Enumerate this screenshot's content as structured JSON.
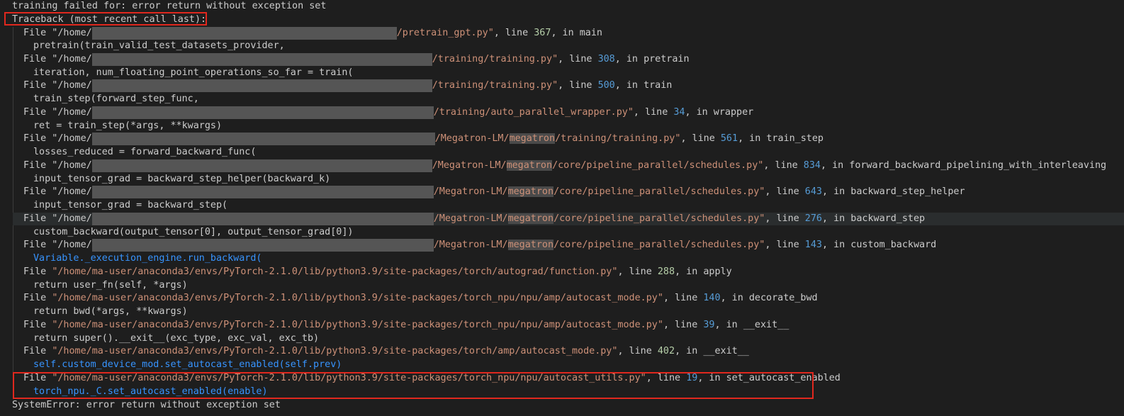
{
  "terminal": {
    "header": "training failed for: error return without exception set",
    "traceback_header": "Traceback (most recent call last):",
    "frames": [
      {
        "prefix": "File \"/home/",
        "path_suffix": "/pretrain_gpt.py",
        "line_label": ", line ",
        "line_no": "367",
        "in_label": ", in ",
        "func": "main",
        "code": "pretrain(train_valid_test_datasets_provider,"
      },
      {
        "prefix": "File \"/home/",
        "path_suffix": "/training/training.py",
        "line_label": ", line ",
        "line_no": "308",
        "in_label": ", in ",
        "func": "pretrain",
        "code": "iteration, num_floating_point_operations_so_far = train("
      },
      {
        "prefix": "File \"/home/",
        "path_suffix": "/training/training.py",
        "line_label": ", line ",
        "line_no": "500",
        "in_label": ", in ",
        "func": "train",
        "code": "train_step(forward_step_func,"
      },
      {
        "prefix": "File \"/home/",
        "path_suffix": "/training/auto_parallel_wrapper.py",
        "line_label": ", line ",
        "line_no": "34",
        "in_label": ", in ",
        "func": "wrapper",
        "code": "ret = train_step(*args, **kwargs)"
      },
      {
        "prefix": "File \"/home/",
        "path_a": "/Megatron-LM/",
        "path_hl": "megatron",
        "path_b": "/training/training.py",
        "line_label": ", line ",
        "line_no": "561",
        "in_label": ", in ",
        "func": "train_step",
        "code": "losses_reduced = forward_backward_func("
      },
      {
        "prefix": "File \"/home/",
        "path_a": "/Megatron-LM/",
        "path_hl": "megatron",
        "path_b": "/core/pipeline_parallel/schedules.py",
        "line_label": ", line ",
        "line_no": "834",
        "in_label": ", in ",
        "func": "forward_backward_pipelining_with_interleaving",
        "code": "input_tensor_grad = backward_step_helper(backward_k)"
      },
      {
        "prefix": "File \"/home/",
        "path_a": "/Megatron-LM/",
        "path_hl": "megatron",
        "path_b": "/core/pipeline_parallel/schedules.py",
        "line_label": ", line ",
        "line_no": "643",
        "in_label": ", in ",
        "func": "backward_step_helper",
        "code": "input_tensor_grad = backward_step("
      },
      {
        "prefix": "File \"/home/",
        "path_a": "/Megatron-LM/",
        "path_hl": "megatron",
        "path_b": "/core/pipeline_parallel/schedules.py",
        "line_label": ", line ",
        "line_no": "276",
        "in_label": ", in ",
        "func": "backward_step",
        "code": "custom_backward(output_tensor[0], output_tensor_grad[0])"
      },
      {
        "prefix": "File \"/home/",
        "path_a": "/Megatron-LM/",
        "path_hl": "megatron",
        "path_b": "/core/pipeline_parallel/schedules.py",
        "line_label": ", line ",
        "line_no": "143",
        "in_label": ", in ",
        "func": "custom_backward",
        "code": "Variable._execution_engine.run_backward("
      },
      {
        "prefix": "File ",
        "path": "\"/home/ma-user/anaconda3/envs/PyTorch-2.1.0/lib/python3.9/site-packages/torch/autograd/function.py\"",
        "line_label": ", line ",
        "line_no": "288",
        "in_label": ", in ",
        "func": "apply",
        "code": "return user_fn(self, *args)"
      },
      {
        "prefix": "File ",
        "path": "\"/home/ma-user/anaconda3/envs/PyTorch-2.1.0/lib/python3.9/site-packages/torch_npu/npu/amp/autocast_mode.py\"",
        "line_label": ", line ",
        "line_no": "140",
        "in_label": ", in ",
        "func": "decorate_bwd",
        "code": "return bwd(*args, **kwargs)"
      },
      {
        "prefix": "File ",
        "path": "\"/home/ma-user/anaconda3/envs/PyTorch-2.1.0/lib/python3.9/site-packages/torch_npu/npu/amp/autocast_mode.py\"",
        "line_label": ", line ",
        "line_no": "39",
        "in_label": ", in ",
        "func": "__exit__",
        "code": "return super().__exit__(exc_type, exc_val, exc_tb)"
      },
      {
        "prefix": "File ",
        "path": "\"/home/ma-user/anaconda3/envs/PyTorch-2.1.0/lib/python3.9/site-packages/torch/amp/autocast_mode.py\"",
        "line_label": ", line ",
        "line_no": "402",
        "in_label": ", in ",
        "func": "__exit__",
        "code": "self.custom_device_mod.set_autocast_enabled(self.prev)"
      },
      {
        "prefix": "File ",
        "path": "\"/home/ma-user/anaconda3/envs/PyTorch-2.1.0/lib/python3.9/site-packages/torch_npu/npu/autocast_utils.py\"",
        "line_label": ", line ",
        "line_no": "19",
        "in_label": ", in ",
        "func": "set_autocast_enabled",
        "code": "torch_npu._C.set_autocast_enabled(enable)"
      }
    ],
    "footer": "SystemError: error return without exception set",
    "colors": {
      "background": "#1e1e1e",
      "text": "#cccccc",
      "string": "#ce9178",
      "number": "#b5cea8",
      "number_alt": "#569cd6",
      "class_ref": "#3794ff",
      "annotation_box": "#e0281e"
    }
  }
}
